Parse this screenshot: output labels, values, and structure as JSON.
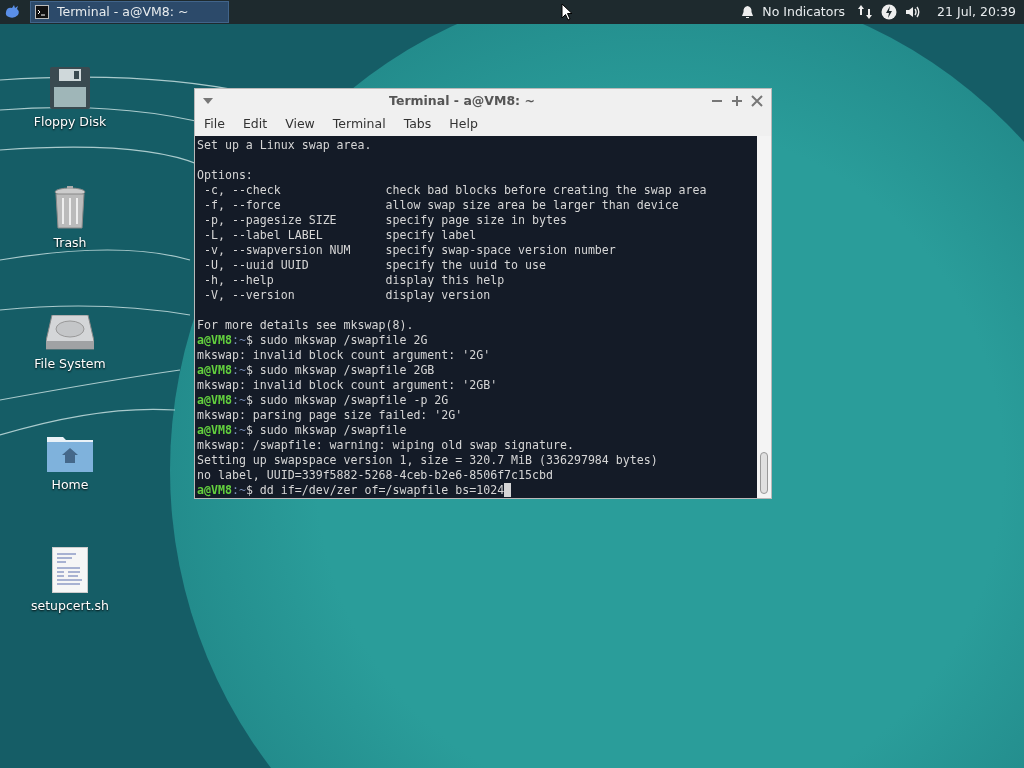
{
  "panel": {
    "task": {
      "title": "Terminal - a@VM8: ~",
      "selected": true
    },
    "indicators_label": "No Indicators",
    "clock": "21 Jul, 20:39"
  },
  "desktop_icons": [
    {
      "kind": "floppy",
      "label": "Floppy Disk"
    },
    {
      "kind": "trash",
      "label": "Trash"
    },
    {
      "kind": "drive",
      "label": "File System"
    },
    {
      "kind": "home",
      "label": "Home"
    },
    {
      "kind": "script",
      "label": "setupcert.sh"
    }
  ],
  "window": {
    "title": "Terminal - a@VM8: ~",
    "menu": [
      "File",
      "Edit",
      "View",
      "Terminal",
      "Tabs",
      "Help"
    ],
    "lines": [
      {
        "kind": "text",
        "text": "Set up a Linux swap area."
      },
      {
        "kind": "blank"
      },
      {
        "kind": "text",
        "text": "Options:"
      },
      {
        "kind": "text",
        "text": " -c, --check               check bad blocks before creating the swap area"
      },
      {
        "kind": "text",
        "text": " -f, --force               allow swap size area be larger than device"
      },
      {
        "kind": "text",
        "text": " -p, --pagesize SIZE       specify page size in bytes"
      },
      {
        "kind": "text",
        "text": " -L, --label LABEL         specify label"
      },
      {
        "kind": "text",
        "text": " -v, --swapversion NUM     specify swap-space version number"
      },
      {
        "kind": "text",
        "text": " -U, --uuid UUID           specify the uuid to use"
      },
      {
        "kind": "text",
        "text": " -h, --help                display this help"
      },
      {
        "kind": "text",
        "text": " -V, --version             display version"
      },
      {
        "kind": "blank"
      },
      {
        "kind": "text",
        "text": "For more details see mkswap(8)."
      },
      {
        "kind": "prompt",
        "user": "a@VM8",
        "path": ":~",
        "command": "$ sudo mkswap /swapfile 2G",
        "cursor": false
      },
      {
        "kind": "text",
        "text": "mkswap: invalid block count argument: '2G'"
      },
      {
        "kind": "prompt",
        "user": "a@VM8",
        "path": ":~",
        "command": "$ sudo mkswap /swapfile 2GB",
        "cursor": false
      },
      {
        "kind": "text",
        "text": "mkswap: invalid block count argument: '2GB'"
      },
      {
        "kind": "prompt",
        "user": "a@VM8",
        "path": ":~",
        "command": "$ sudo mkswap /swapfile -p 2G",
        "cursor": false
      },
      {
        "kind": "text",
        "text": "mkswap: parsing page size failed: '2G'"
      },
      {
        "kind": "prompt",
        "user": "a@VM8",
        "path": ":~",
        "command": "$ sudo mkswap /swapfile",
        "cursor": false
      },
      {
        "kind": "text",
        "text": "mkswap: /swapfile: warning: wiping old swap signature."
      },
      {
        "kind": "text",
        "text": "Setting up swapspace version 1, size = 320.7 MiB (336297984 bytes)"
      },
      {
        "kind": "text",
        "text": "no label, UUID=339f5882-5268-4ceb-b2e6-8506f7c15cbd"
      },
      {
        "kind": "prompt",
        "user": "a@VM8",
        "path": ":~",
        "command": "$ dd if=/dev/zer of=/swapfile bs=1024",
        "cursor": true
      }
    ]
  }
}
